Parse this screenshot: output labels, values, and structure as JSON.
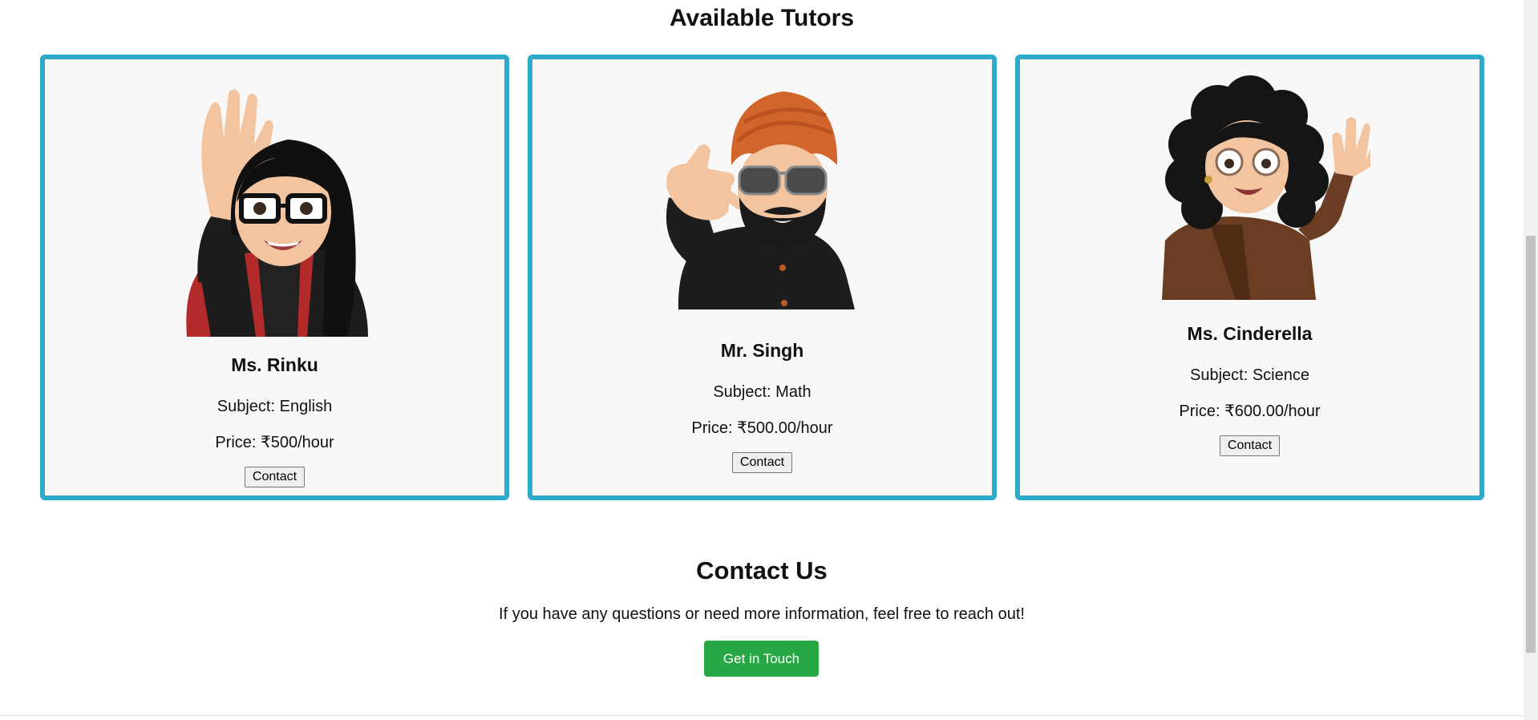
{
  "tutors_section": {
    "title": "Available Tutors"
  },
  "tutors": [
    {
      "name": "Ms. Rinku",
      "subject": "Subject: English",
      "price": "Price: ₹500/hour",
      "button": "Contact",
      "avatar": "memoji-woman-waving-glasses-icon"
    },
    {
      "name": "Mr. Singh",
      "subject": "Subject: Math",
      "price": "Price: ₹500.00/hour",
      "button": "Contact",
      "avatar": "memoji-man-turban-call-me-icon"
    },
    {
      "name": "Ms. Cinderella",
      "subject": "Subject: Science",
      "price": "Price: ₹600.00/hour",
      "button": "Contact",
      "avatar": "memoji-woman-curly-hair-waving-icon"
    }
  ],
  "contact_section": {
    "title": "Contact Us",
    "text": "If you have any questions or need more information, feel free to reach out!",
    "button": "Get in Touch"
  },
  "colors": {
    "card_border": "#2eaacb",
    "card_bg": "#f8f8f8",
    "cta": "#28a745"
  }
}
